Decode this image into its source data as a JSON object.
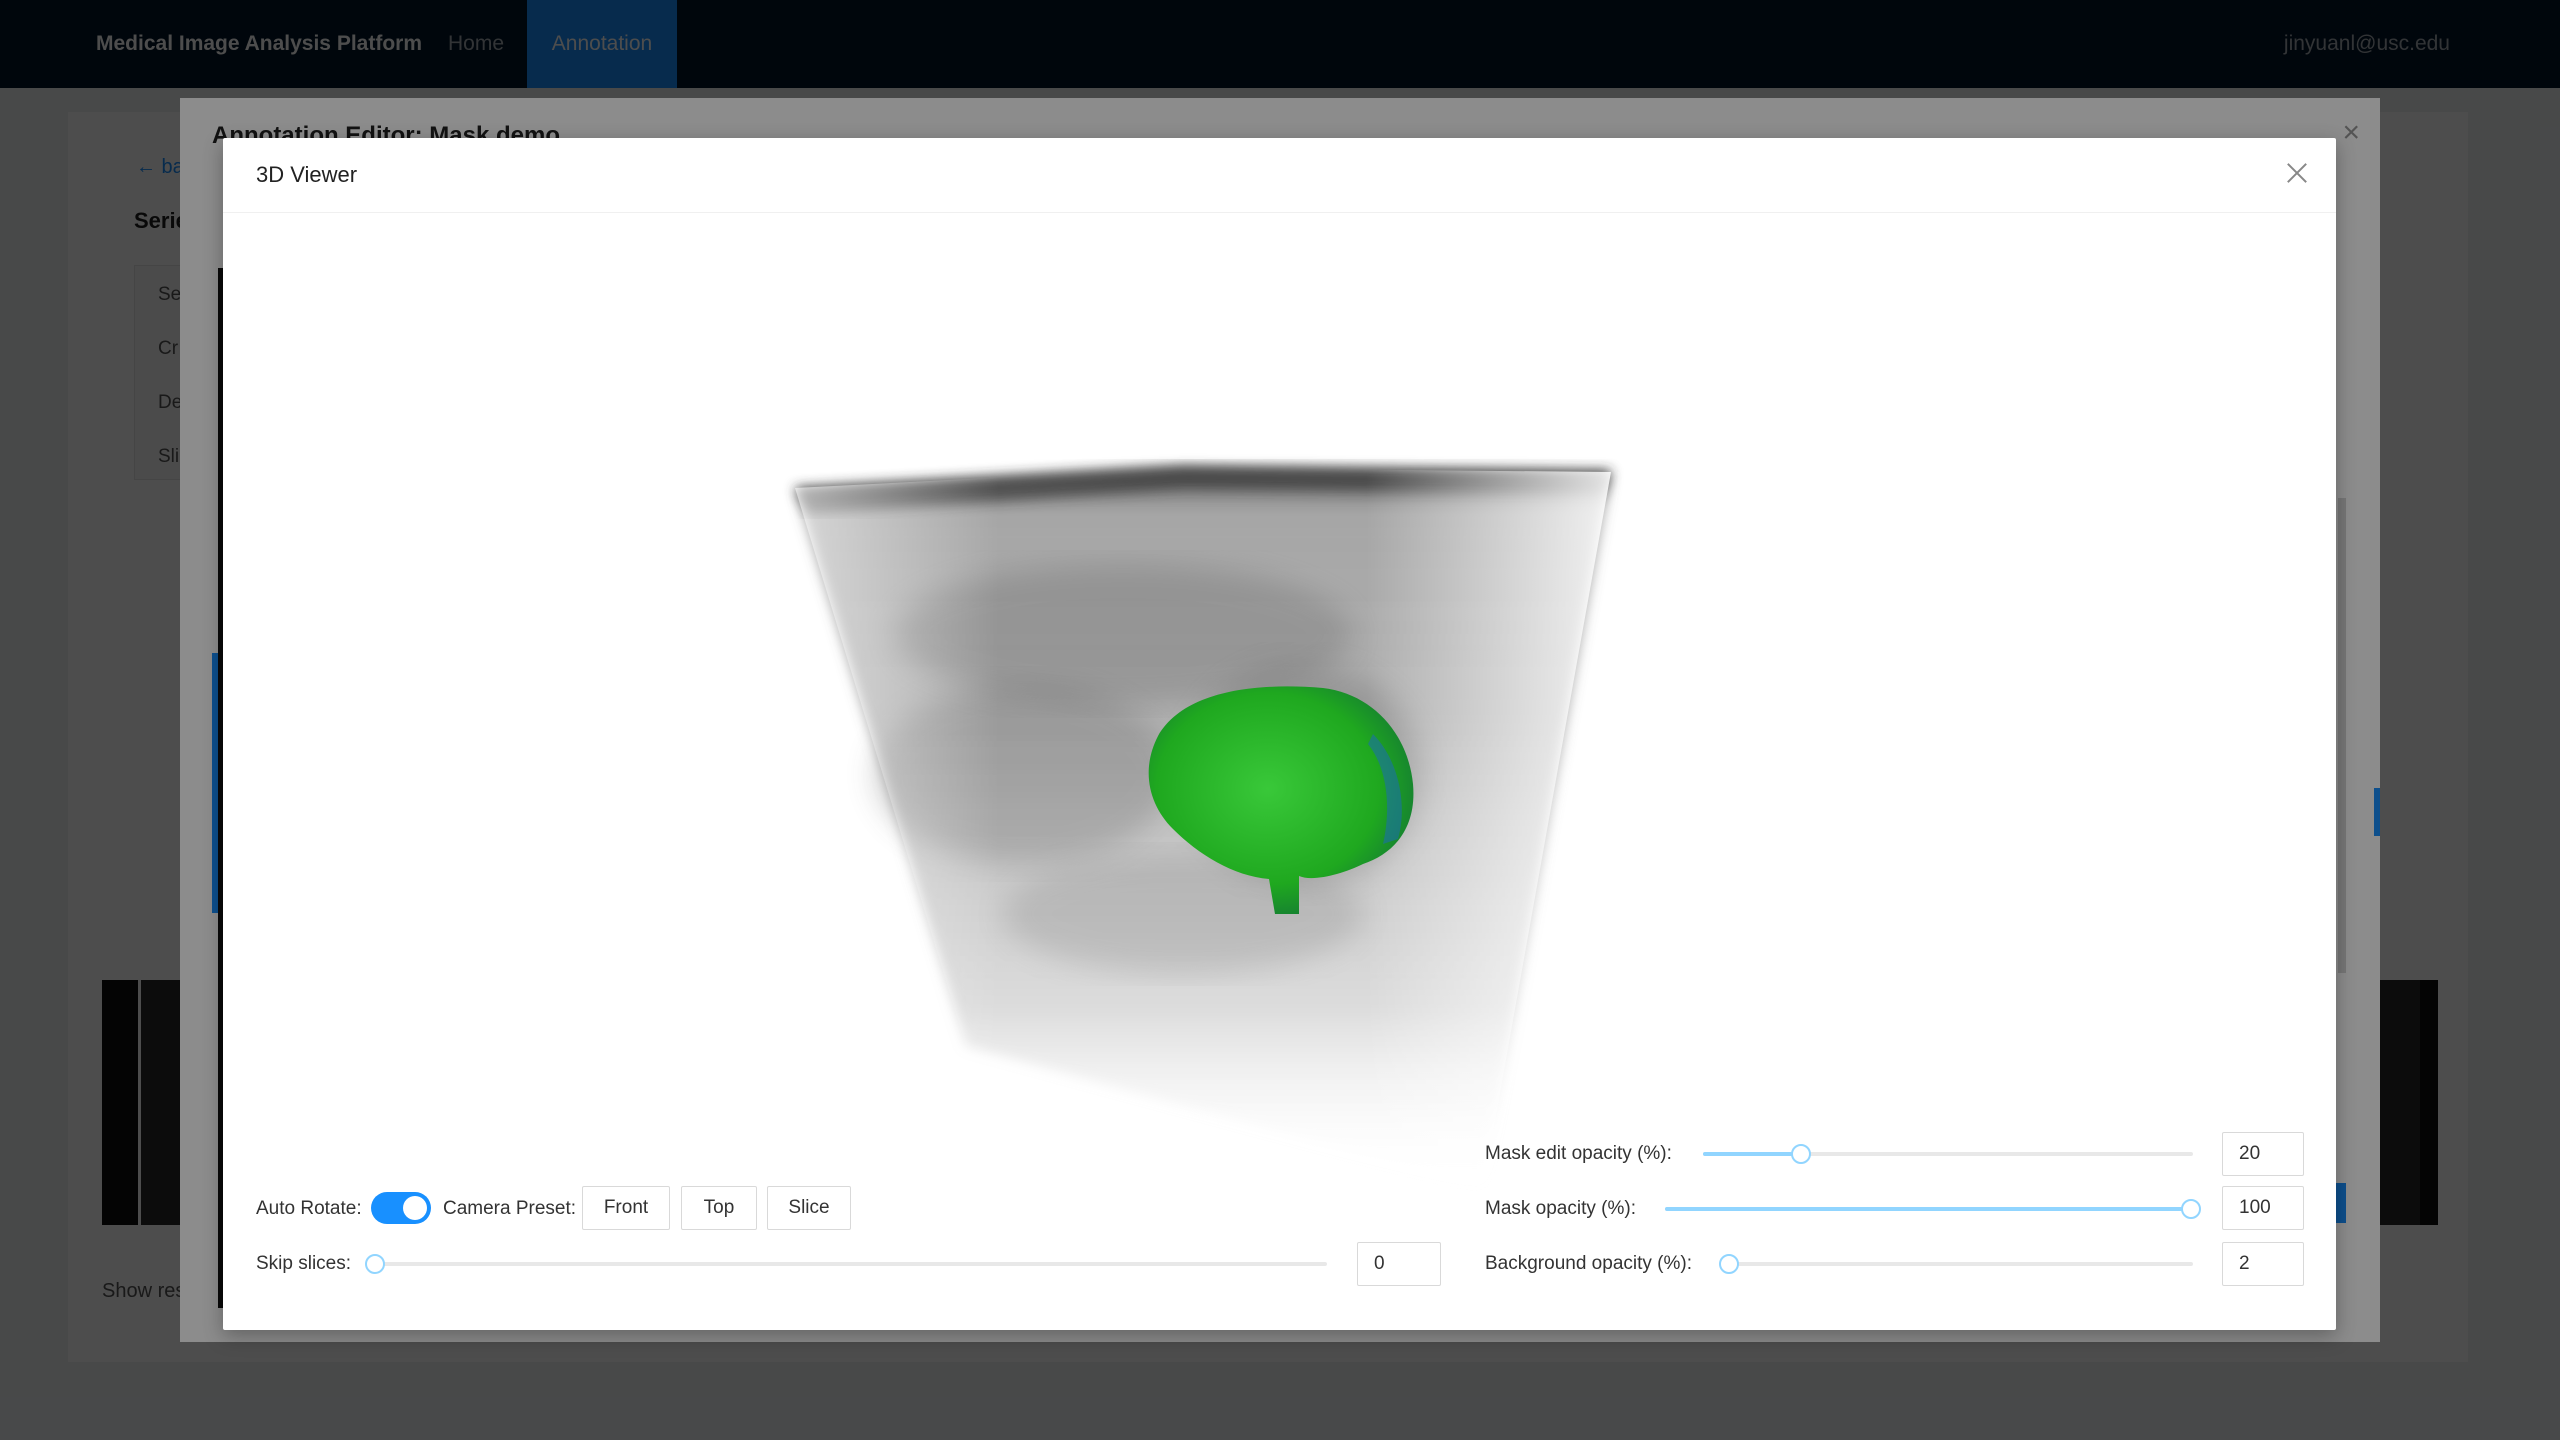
{
  "topbar": {
    "brand": "Medical Image Analysis Platform",
    "nav": {
      "home": "Home",
      "annotation": "Annotation"
    },
    "user": "jinyuanl@usc.edu"
  },
  "page": {
    "back": "← ba",
    "series_heading": "Serie",
    "info_rows": [
      "Se",
      "Cr",
      "De",
      "Sli"
    ],
    "show_results": "Show res"
  },
  "editor": {
    "title": "Annotation Editor: Mask demo",
    "close": "×"
  },
  "viewer": {
    "title": "3D Viewer",
    "auto_rotate": {
      "label": "Auto Rotate:",
      "enabled": true
    },
    "camera_preset": {
      "label": "Camera Preset:",
      "buttons": [
        "Front",
        "Top",
        "Slice"
      ]
    },
    "skip_slices": {
      "label": "Skip slices:",
      "value": "0",
      "fraction": 0.0
    },
    "mask_edit_opacity": {
      "label": "Mask edit opacity (%):",
      "value": "20",
      "percent": 20
    },
    "mask_opacity": {
      "label": "Mask opacity (%):",
      "value": "100",
      "percent": 100
    },
    "background_opacity": {
      "label": "Background opacity (%):",
      "value": "2",
      "percent": 2
    },
    "colors": {
      "accent": "#1890ff",
      "mask": "#22b422",
      "slider": "#91d5ff"
    }
  }
}
